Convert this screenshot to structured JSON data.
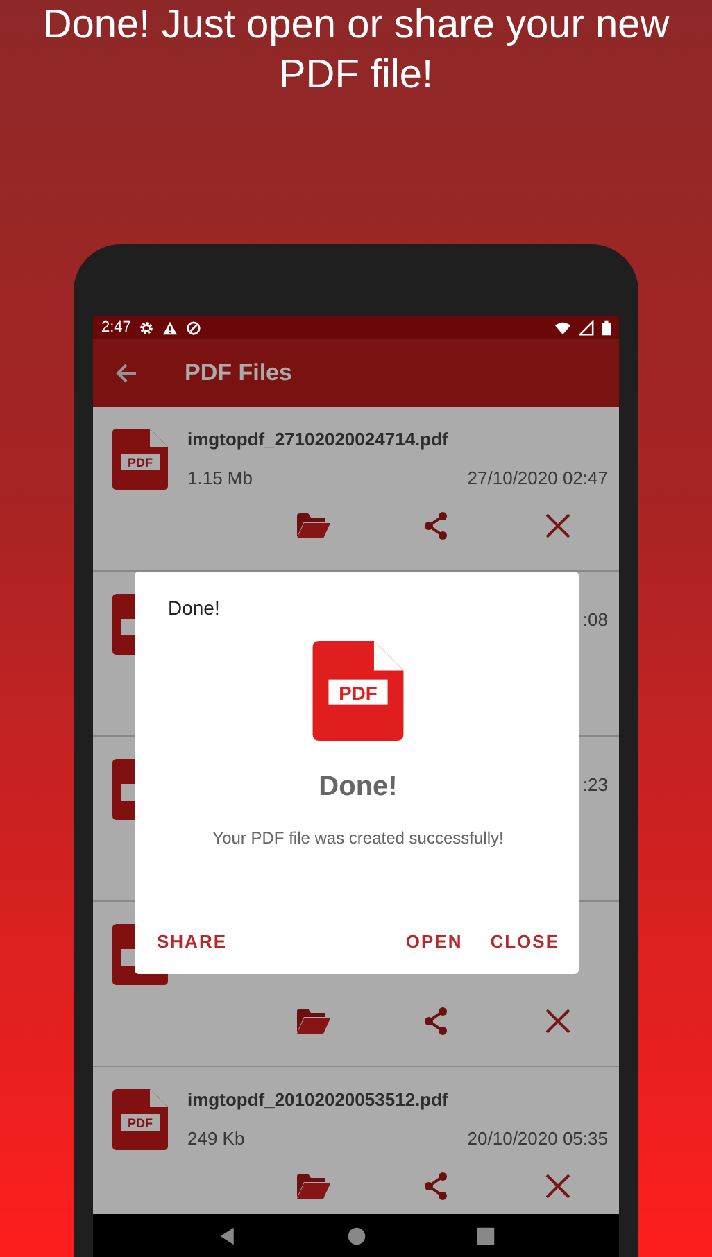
{
  "headline": [
    "Done! Just open or share your new",
    "PDF file!"
  ],
  "status_bar": {
    "time": "2:47"
  },
  "app_bar": {
    "title": "PDF Files"
  },
  "files": [
    {
      "kind": "file",
      "icon_label": "PDF",
      "name": "imgtopdf_27102020024714.pdf",
      "size": "1.15 Mb",
      "date": "27/10/2020 02:47"
    },
    {
      "kind": "covered",
      "date": ":08"
    },
    {
      "kind": "covered",
      "date": ":23"
    },
    {
      "kind": "actions_only"
    },
    {
      "kind": "file",
      "icon_label": "PDF",
      "name": "imgtopdf_20102020053512.pdf",
      "size": "249 Kb",
      "date": "20/10/2020 05:35"
    }
  ],
  "dialog": {
    "title": "Done!",
    "icon_label": "PDF",
    "heading": "Done!",
    "message": "Your PDF file was created successfully!",
    "buttons": [
      {
        "label": "SHARE",
        "kind": "left"
      },
      {
        "label": "OPEN",
        "kind": "right"
      },
      {
        "label": "CLOSE",
        "kind": "right"
      }
    ]
  }
}
